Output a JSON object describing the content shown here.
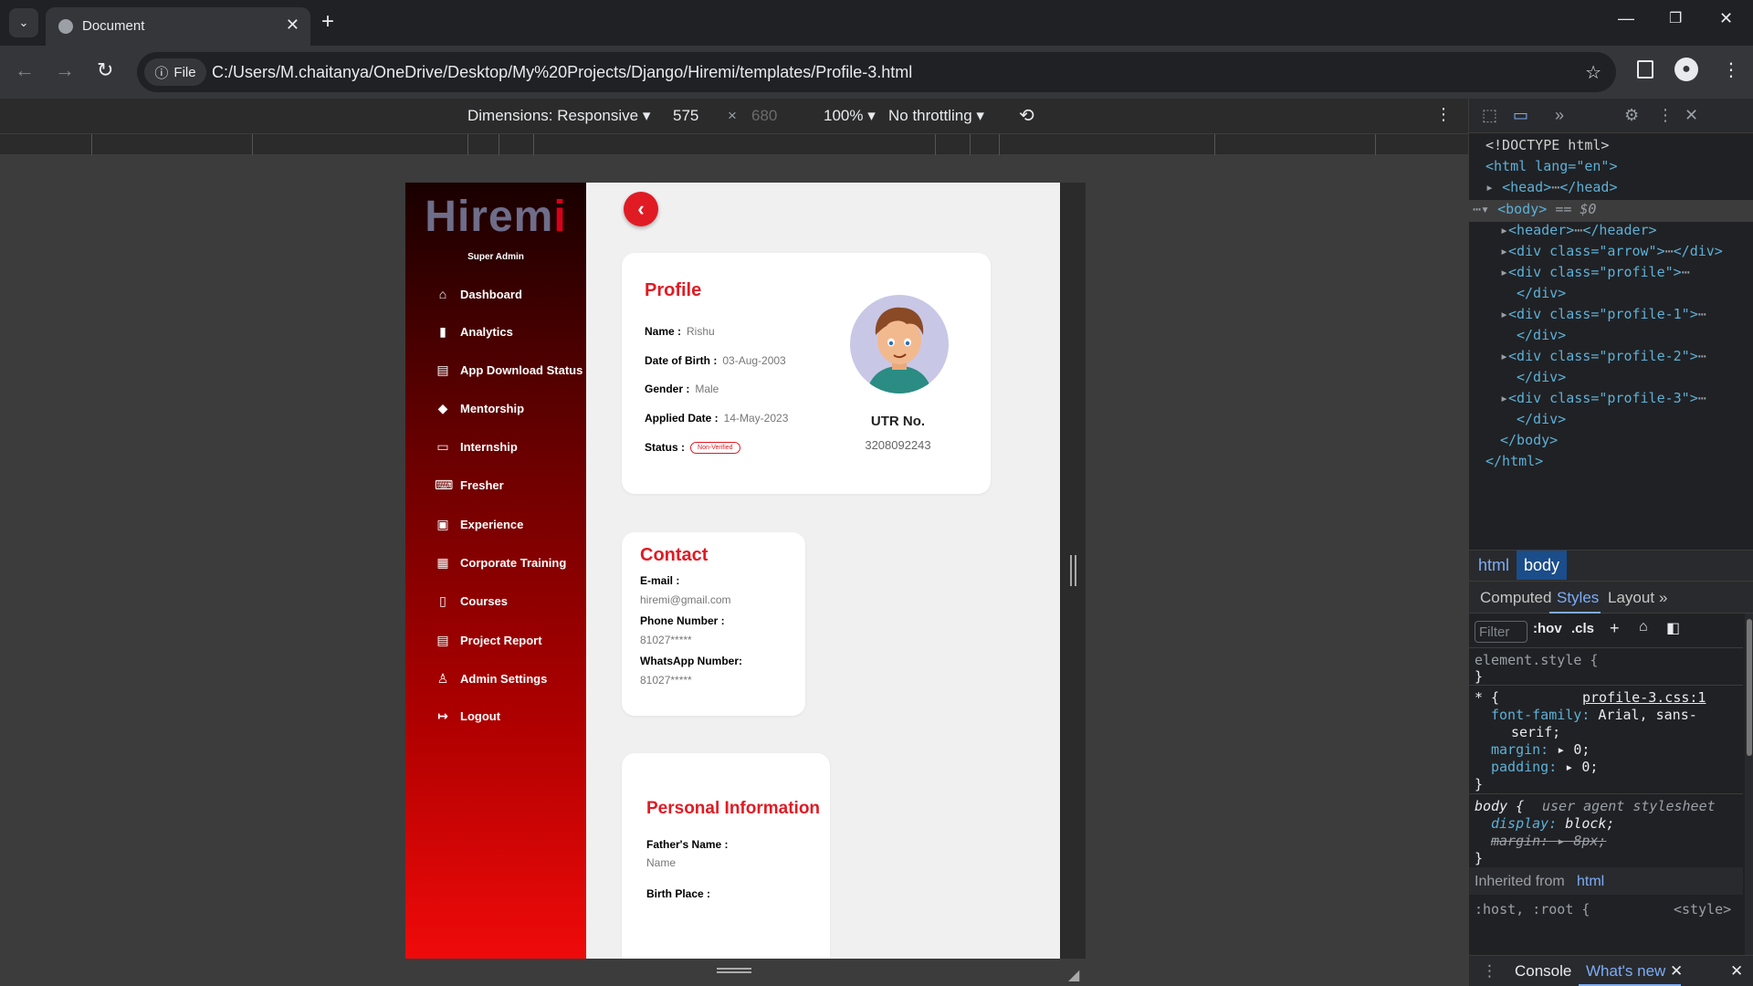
{
  "browser": {
    "tab_title": "Document",
    "file_chip": "File",
    "url": "C:/Users/M.chaitanya/OneDrive/Desktop/My%20Projects/Django/Hiremi/templates/Profile-3.html"
  },
  "device_toolbar": {
    "dimensions": "Dimensions: Responsive",
    "width": "575",
    "times": "×",
    "height": "680",
    "zoom": "100%",
    "throttling": "No throttling"
  },
  "sidebar": {
    "logo": "Hiremi",
    "role": "Super Admin",
    "items": [
      {
        "label": "Dashboard",
        "icon": "home-icon"
      },
      {
        "label": "Analytics",
        "icon": "bar-chart-icon"
      },
      {
        "label": "App Download Status",
        "icon": "file-download-icon"
      },
      {
        "label": "Mentorship",
        "icon": "graduation-cap-icon"
      },
      {
        "label": "Internship",
        "icon": "monitor-icon"
      },
      {
        "label": "Fresher",
        "icon": "laptop-code-icon"
      },
      {
        "label": "Experience",
        "icon": "briefcase-icon"
      },
      {
        "label": "Corporate Training",
        "icon": "sitemap-icon"
      },
      {
        "label": "Courses",
        "icon": "file-icon"
      },
      {
        "label": "Project Report",
        "icon": "file-text-icon"
      },
      {
        "label": "Admin Settings",
        "icon": "user-icon"
      },
      {
        "label": "Logout",
        "icon": "logout-icon"
      }
    ]
  },
  "profile": {
    "title": "Profile",
    "name_label": "Name :",
    "name": "Rishu",
    "dob_label": "Date of Birth :",
    "dob": "03-Aug-2003",
    "gender_label": "Gender :",
    "gender": "Male",
    "applied_label": "Applied Date :",
    "applied": "14-May-2023",
    "status_label": "Status :",
    "status": "Non-Verified",
    "utr_label": "UTR No.",
    "utr": "3208092243"
  },
  "contact": {
    "title": "Contact",
    "email_label": "E-mail :",
    "email": "hiremi@gmail.com",
    "phone_label": "Phone Number :",
    "phone": "81027*****",
    "whatsapp_label": "WhatsApp Number:",
    "whatsapp": "81027*****"
  },
  "personal": {
    "title": "Personal Information",
    "father_label": "Father's Name :",
    "father": "Name",
    "birthplace_label": "Birth Place :"
  },
  "devtools": {
    "dom": {
      "doctype": "<!DOCTYPE html>",
      "html_open": "<html lang=\"en\">",
      "head": "<head>",
      "head_close": "</head>",
      "body": "<body>",
      "body_sel": "== $0",
      "header": "<header>",
      "header_close": "</header>",
      "div_arrow": "<div class=\"arrow\">",
      "div_close": "</div>",
      "div_profile": "<div class=\"profile\">",
      "div_profile1": "<div class=\"profile-1\">",
      "div_profile2": "<div class=\"profile-2\">",
      "div_profile3": "<div class=\"profile-3\">",
      "body_close": "</body>",
      "html_close": "</html>"
    },
    "breadcrumbs": [
      "html",
      "body"
    ],
    "style_tabs": [
      "Computed",
      "Styles",
      "Layout"
    ],
    "filter_placeholder": "Filter",
    "hov": ":hov",
    "cls": ".cls",
    "styles": {
      "element_style": "element.style {",
      "brace_close": "}",
      "star_rule": "* {",
      "source": "profile-3.css:1",
      "font_family_prop": "font-family:",
      "font_family_val": "Arial, sans-",
      "font_family_val2": "serif;",
      "margin_prop": "margin:",
      "margin_val": "0;",
      "padding_prop": "padding:",
      "padding_val": "0;",
      "body_rule": "body {",
      "ua": "user agent stylesheet",
      "display_prop": "display:",
      "display_val": "block;",
      "margin_struck": "margin:",
      "margin_struck_val": "8px;",
      "inherited": "Inherited from",
      "inherited_el": "html",
      "host_rule": ":host, :root {",
      "style_src": "<style>"
    },
    "drawer_tabs": [
      "Console",
      "What's new"
    ]
  }
}
